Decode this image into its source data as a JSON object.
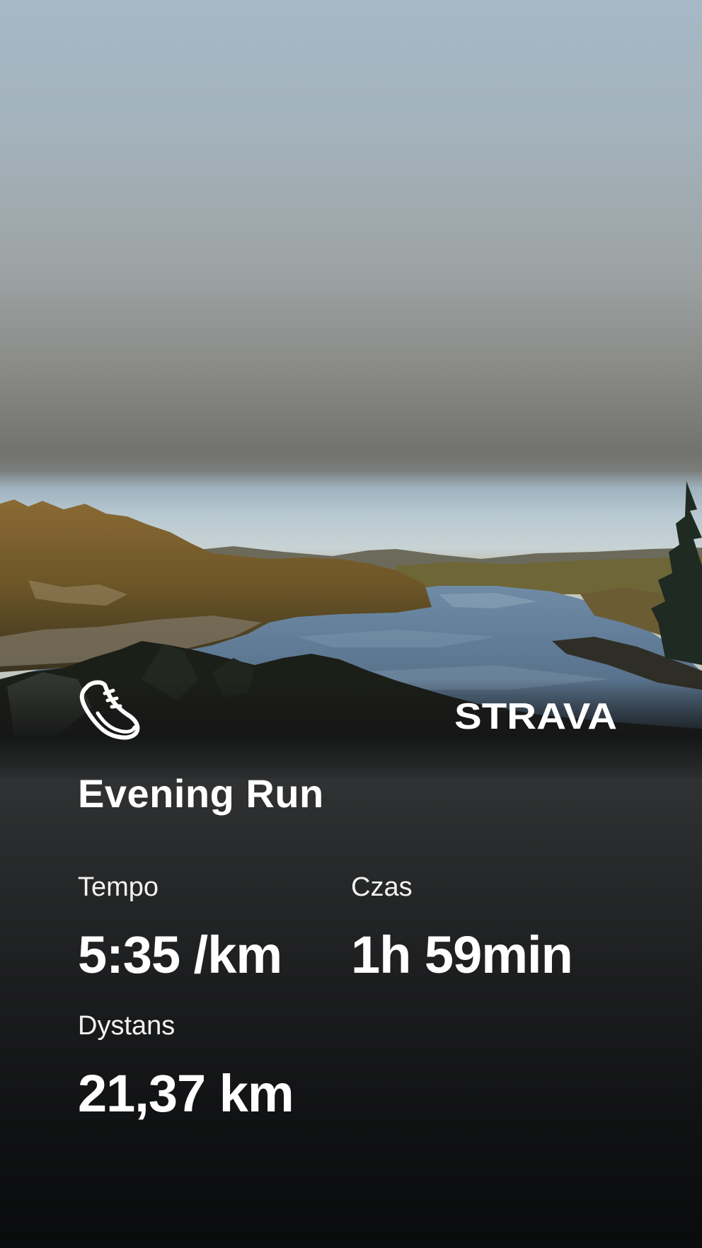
{
  "activity": {
    "title": "Evening Run",
    "type_icon": "running-shoe-icon"
  },
  "brand": {
    "logo_text": "STRAVA",
    "logo_color": "#ffffff"
  },
  "stats": [
    {
      "label": "Tempo",
      "value": "5:35 /km"
    },
    {
      "label": "Czas",
      "value": "1h 59min"
    },
    {
      "label": "Dystans",
      "value": "21,37 km"
    }
  ],
  "colors": {
    "text": "#ffffff",
    "background_bottom": "#0a0b0c"
  }
}
